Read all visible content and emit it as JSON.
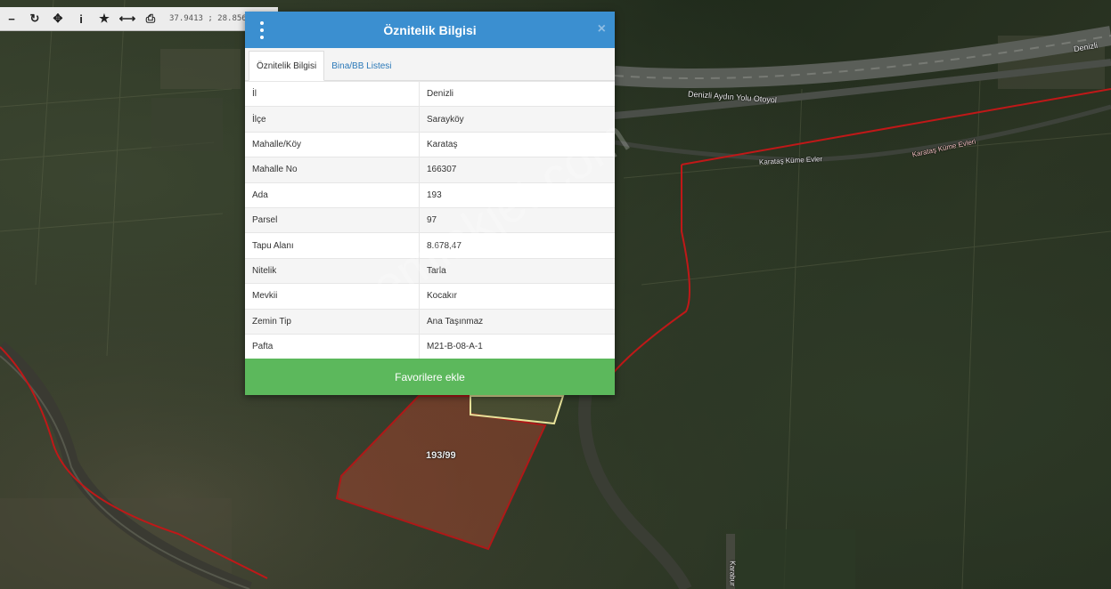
{
  "toolbar": {
    "coords": "37.9413 ; 28.8563",
    "icons": [
      "minus-icon",
      "refresh-icon",
      "move-icon",
      "info-icon",
      "star-icon",
      "measure-icon",
      "print-icon"
    ]
  },
  "map": {
    "labels": {
      "highway": "Denizli Aydın Yolu Otoyol",
      "highway_right": "Denizli",
      "street1": "Karataş Küme Evler",
      "street2": "Karataş Küme Evleri",
      "parcel": "193/99",
      "road_vertical": "Karabur"
    },
    "colors": {
      "parcel_border": "#c01818",
      "parcel_fill": "#d6442e",
      "highlight": "#e8e39a"
    }
  },
  "dialog": {
    "title": "Öznitelik Bilgisi",
    "close": "×",
    "tabs": [
      "Öznitelik Bilgisi",
      "Bina/BB Listesi"
    ],
    "rows": [
      {
        "key": "İl",
        "value": "Denizli"
      },
      {
        "key": "İlçe",
        "value": "Sarayköy"
      },
      {
        "key": "Mahalle/Köy",
        "value": "Karataş"
      },
      {
        "key": "Mahalle No",
        "value": "166307"
      },
      {
        "key": "Ada",
        "value": "193"
      },
      {
        "key": "Parsel",
        "value": "97"
      },
      {
        "key": "Tapu Alanı",
        "value": "8.678,47"
      },
      {
        "key": "Nitelik",
        "value": "Tarla"
      },
      {
        "key": "Mevkii",
        "value": "Kocakır"
      },
      {
        "key": "Zemin Tip",
        "value": "Ana Taşınmaz"
      },
      {
        "key": "Pafta",
        "value": "M21-B-08-A-1"
      }
    ],
    "favorite_button": "Favorilere ekle",
    "header_color": "#3b8fd0",
    "button_color": "#5cb85c"
  },
  "watermark": "emlakjet.com"
}
